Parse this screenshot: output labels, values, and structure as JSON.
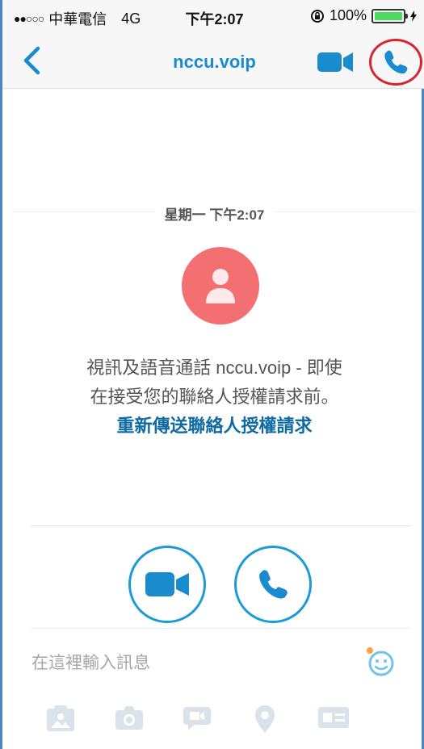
{
  "status_bar": {
    "signal": "●●○○○",
    "carrier": "中華電信",
    "network": "4G",
    "time": "下午2:07",
    "battery_percent": "100%",
    "battery_level": 1.0
  },
  "navbar": {
    "title": "nccu.voip",
    "icons": [
      "back-chevron-icon",
      "video-camera-icon",
      "phone-icon"
    ],
    "accent_color": "#1a8ccd",
    "highlight_color": "#d9232d"
  },
  "conversation": {
    "date_label": "星期一 下午2:07",
    "avatar_color": "#f36f72",
    "message_line1": "視訊及語音通話 nccu.voip - 即使",
    "message_line2": "在接受您的聯絡人授權請求前。",
    "resend_link": "重新傳送聯絡人授權請求"
  },
  "actions": {
    "icons": [
      "video-camera-icon",
      "phone-icon"
    ]
  },
  "composer": {
    "placeholder": "在這裡輸入訊息",
    "value": "",
    "tool_icons": [
      "media-gallery-icon",
      "camera-icon",
      "video-message-icon",
      "location-pin-icon",
      "contact-card-icon",
      "emoji-icon"
    ]
  }
}
